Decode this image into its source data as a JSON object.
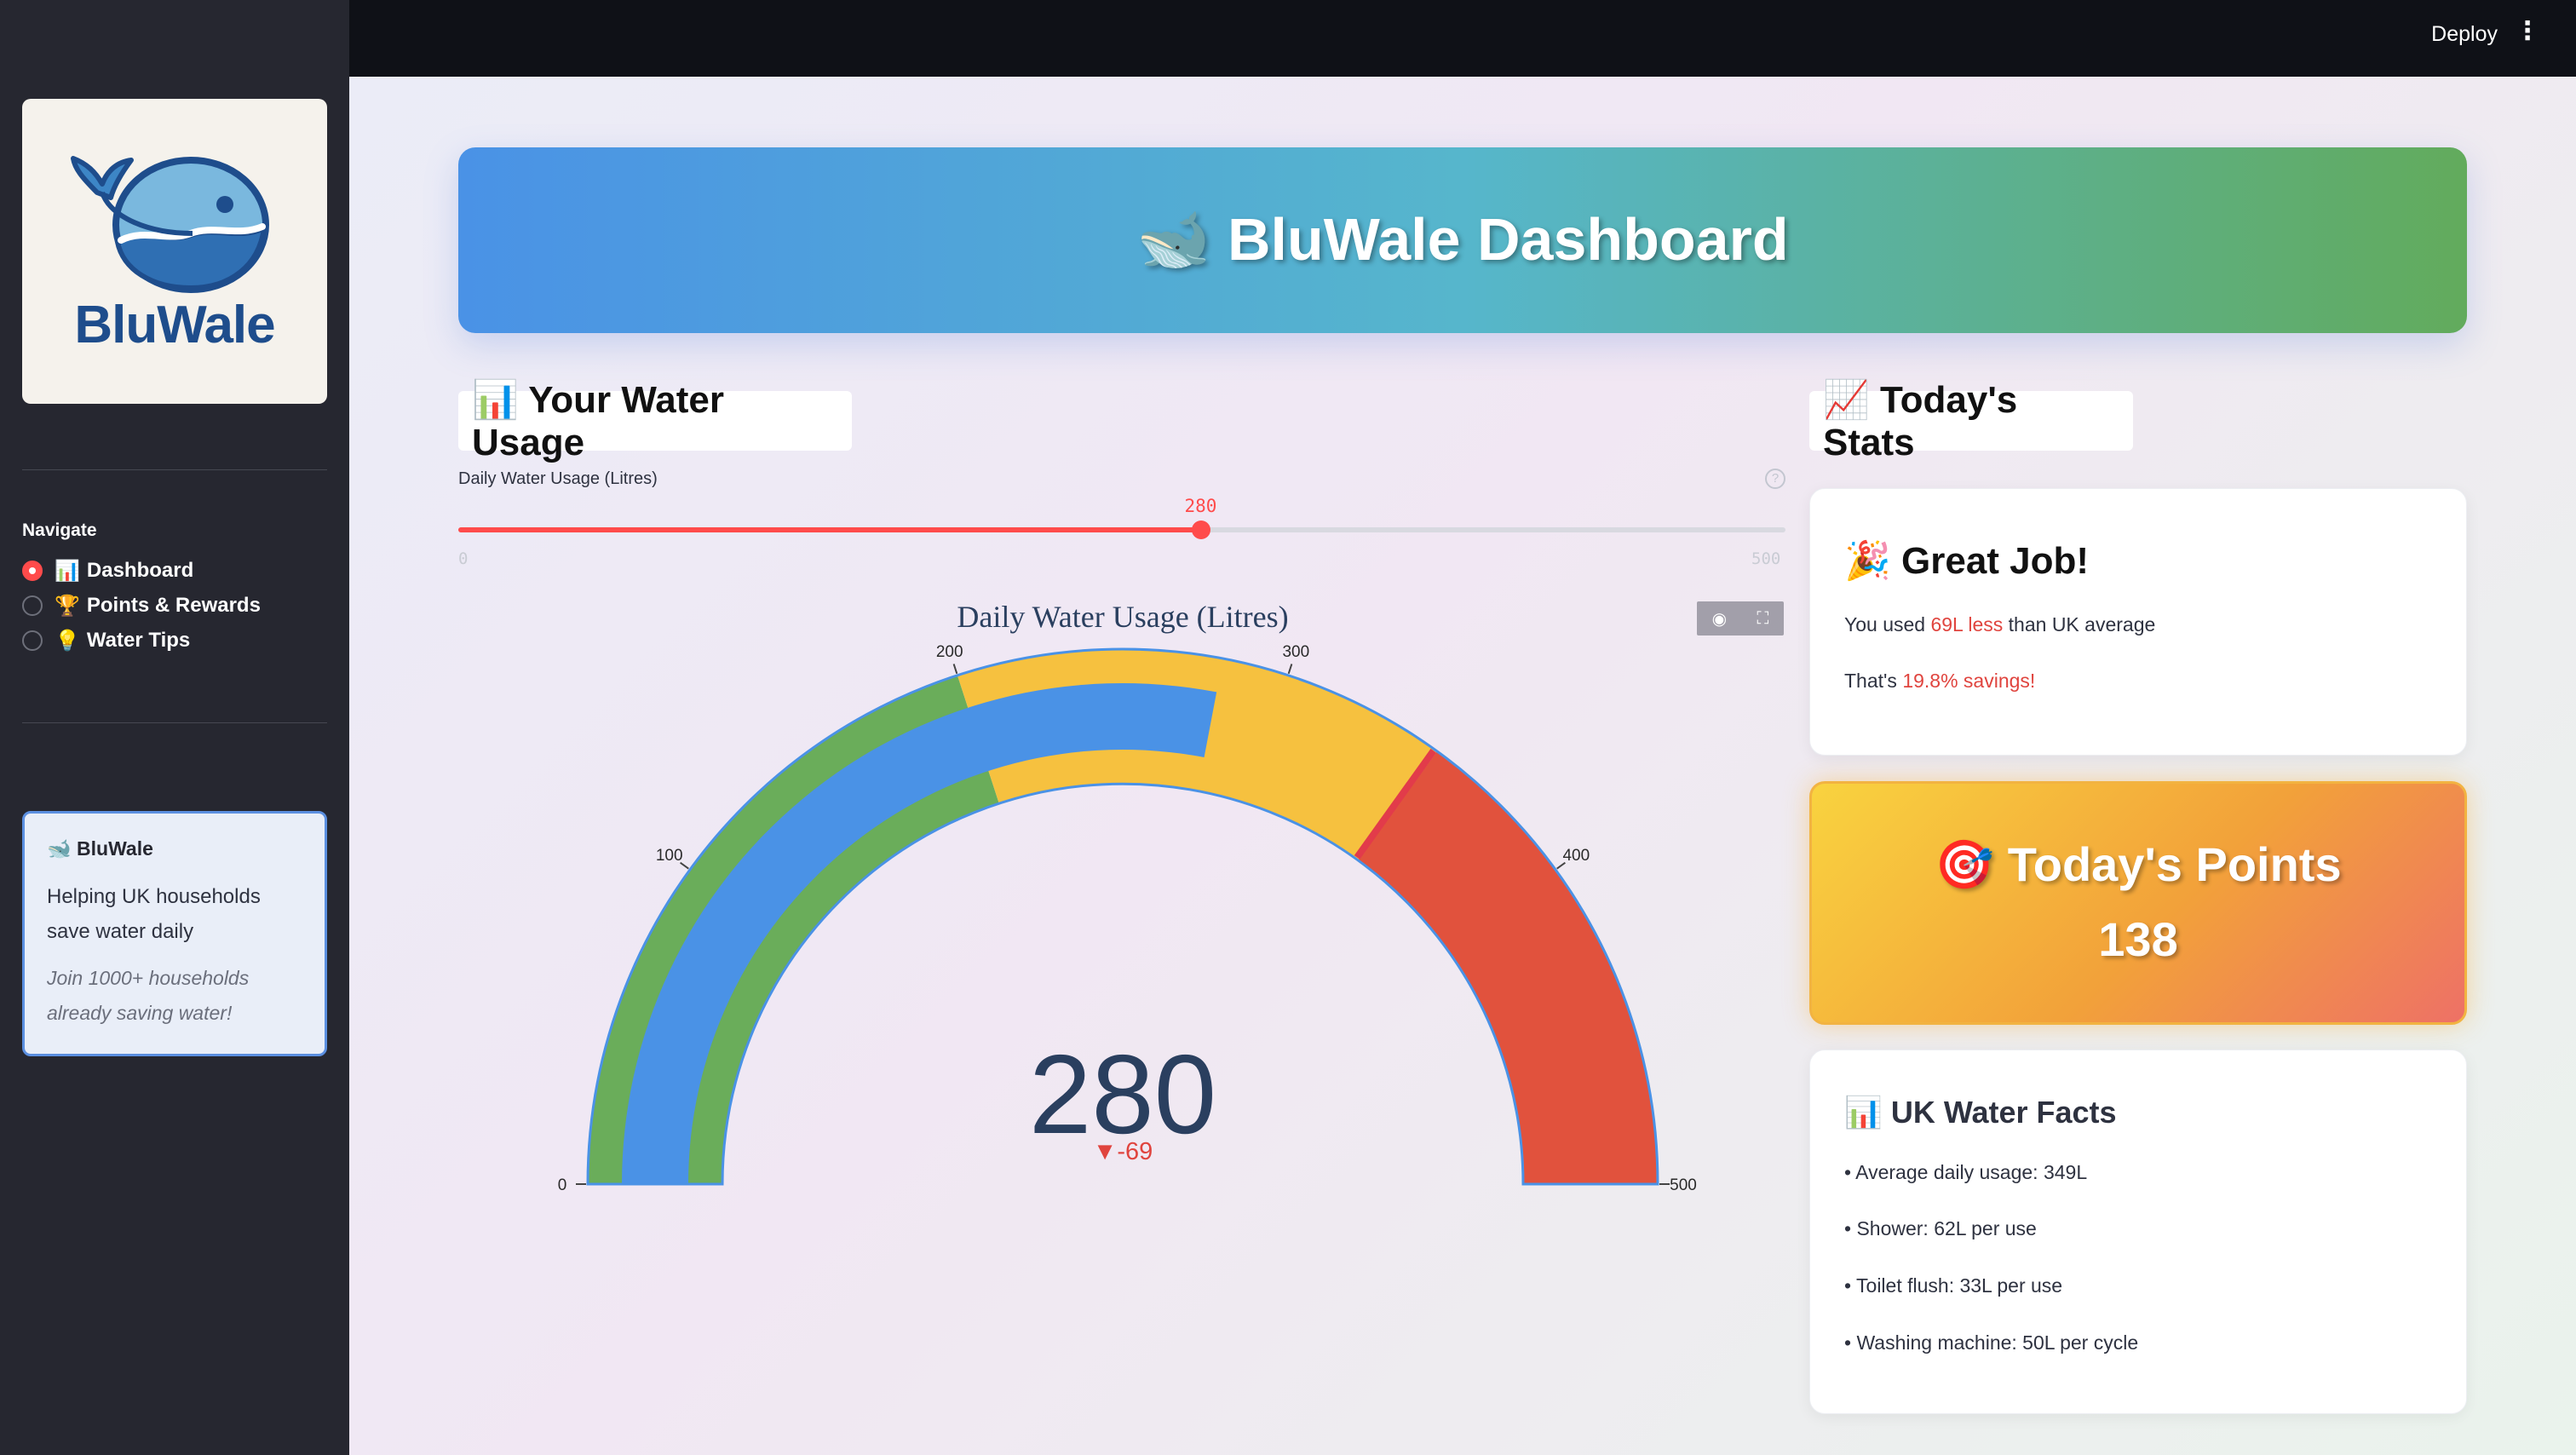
{
  "app": {
    "deploy_label": "Deploy",
    "menu_icon": "kebab-menu-icon"
  },
  "sidebar": {
    "logo_text": "BluWale",
    "nav_title": "Navigate",
    "nav_items": [
      {
        "emoji": "📊",
        "label": "Dashboard",
        "selected": true
      },
      {
        "emoji": "🏆",
        "label": "Points & Rewards",
        "selected": false
      },
      {
        "emoji": "💡",
        "label": "Water Tips",
        "selected": false
      }
    ],
    "info": {
      "title": "🐋 BluWale",
      "line1": "Helping UK households",
      "line2": "save water daily",
      "italic1": "Join 1000+ households",
      "italic2": "already saving water!"
    }
  },
  "banner": {
    "title": "🐋 BluWale Dashboard"
  },
  "usage_section": {
    "title": "📊 Your Water Usage",
    "slider_label": "Daily Water Usage (Litres)",
    "slider_value": "280",
    "slider_min": "0",
    "slider_max": "500",
    "value_fraction": 0.56
  },
  "chart_data": {
    "type": "gauge",
    "title": "Daily Water Usage (Litres)",
    "value": 280,
    "delta": "▼-69",
    "reference": 349,
    "range": [
      0,
      500
    ],
    "ticks": [
      "0",
      "100",
      "200",
      "300",
      "400",
      "500"
    ],
    "steps": [
      {
        "range": [
          0,
          200
        ],
        "color": "#6aad5a"
      },
      {
        "range": [
          200,
          350
        ],
        "color": "#f6c13f"
      },
      {
        "range": [
          350,
          500
        ],
        "color": "#e1523d"
      }
    ],
    "bar_color": "#4a92e6",
    "threshold": 349,
    "threshold_color": "#e23b4a"
  },
  "stats_section": {
    "title": "📈 Today's Stats",
    "great_job": "🎉 Great Job!",
    "line1_prefix": "You used ",
    "line1_highlight": "69L less",
    "line1_suffix": " than UK average",
    "line2_prefix": "That's ",
    "line2_highlight": "19.8% savings!"
  },
  "points": {
    "title": "🎯 Today's Points",
    "value": "138"
  },
  "facts": {
    "title": "📊 UK Water Facts",
    "items": [
      "• Average daily usage: 349L",
      "• Shower: 62L per use",
      "• Toilet flush: 33L per use",
      "• Washing machine: 50L per cycle"
    ]
  },
  "colors": {
    "accent": "#ff4b4b",
    "sidebar_bg": "#262730",
    "header_bg": "#0f1117",
    "highlight_red": "#e0443e"
  }
}
